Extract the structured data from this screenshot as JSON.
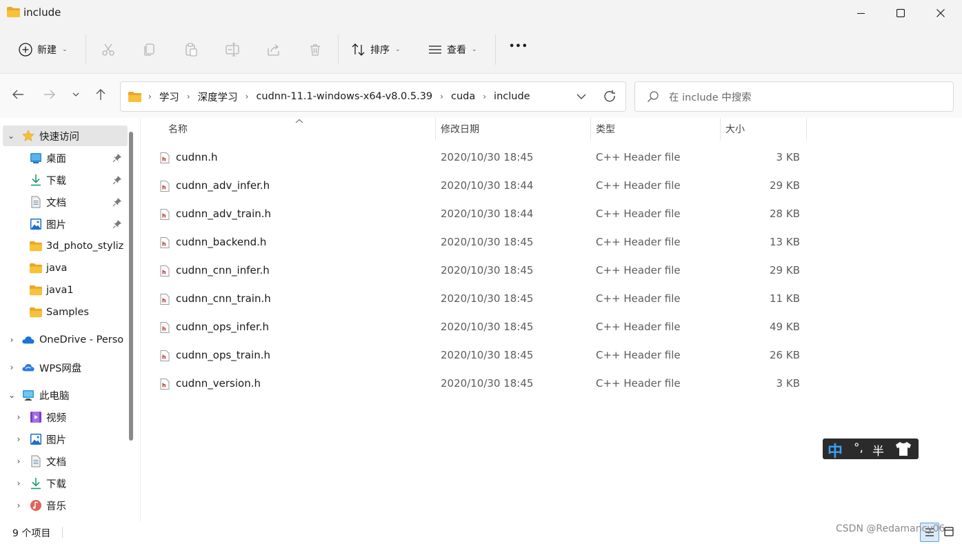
{
  "window": {
    "title": "include"
  },
  "toolbar": {
    "new_label": "新建",
    "sort_label": "排序",
    "view_label": "查看",
    "more_label": "•••"
  },
  "address": {
    "crumbs": [
      "学习",
      "深度学习",
      "cudnn-11.1-windows-x64-v8.0.5.39",
      "cuda",
      "include"
    ]
  },
  "search": {
    "placeholder": "在 include 中搜索"
  },
  "sidebar": {
    "quick_access": "快速访问",
    "items": [
      {
        "label": "桌面",
        "icon": "desktop-icon",
        "pinned": true
      },
      {
        "label": "下载",
        "icon": "download-icon",
        "pinned": true
      },
      {
        "label": "文档",
        "icon": "document-icon",
        "pinned": true
      },
      {
        "label": "图片",
        "icon": "pictures-icon",
        "pinned": true
      },
      {
        "label": "3d_photo_styliz",
        "icon": "folder-icon",
        "pinned": false
      },
      {
        "label": "java",
        "icon": "folder-icon",
        "pinned": false
      },
      {
        "label": "java1",
        "icon": "folder-icon",
        "pinned": false
      },
      {
        "label": "Samples",
        "icon": "folder-icon",
        "pinned": false
      }
    ],
    "onedrive": "OneDrive - Perso",
    "wps": "WPS网盘",
    "this_pc": "此电脑",
    "pc_items": [
      {
        "label": "视频",
        "icon": "video-icon"
      },
      {
        "label": "图片",
        "icon": "pictures-icon"
      },
      {
        "label": "文档",
        "icon": "document-icon"
      },
      {
        "label": "下载",
        "icon": "download-icon"
      },
      {
        "label": "音乐",
        "icon": "music-icon"
      }
    ]
  },
  "columns": {
    "name": "名称",
    "date": "修改日期",
    "type": "类型",
    "size": "大小"
  },
  "files": [
    {
      "name": "cudnn.h",
      "date": "2020/10/30 18:45",
      "type": "C++ Header file",
      "size": "3 KB"
    },
    {
      "name": "cudnn_adv_infer.h",
      "date": "2020/10/30 18:44",
      "type": "C++ Header file",
      "size": "29 KB"
    },
    {
      "name": "cudnn_adv_train.h",
      "date": "2020/10/30 18:44",
      "type": "C++ Header file",
      "size": "28 KB"
    },
    {
      "name": "cudnn_backend.h",
      "date": "2020/10/30 18:45",
      "type": "C++ Header file",
      "size": "13 KB"
    },
    {
      "name": "cudnn_cnn_infer.h",
      "date": "2020/10/30 18:45",
      "type": "C++ Header file",
      "size": "29 KB"
    },
    {
      "name": "cudnn_cnn_train.h",
      "date": "2020/10/30 18:45",
      "type": "C++ Header file",
      "size": "11 KB"
    },
    {
      "name": "cudnn_ops_infer.h",
      "date": "2020/10/30 18:45",
      "type": "C++ Header file",
      "size": "49 KB"
    },
    {
      "name": "cudnn_ops_train.h",
      "date": "2020/10/30 18:45",
      "type": "C++ Header file",
      "size": "26 KB"
    },
    {
      "name": "cudnn_version.h",
      "date": "2020/10/30 18:45",
      "type": "C++ Header file",
      "size": "3 KB"
    }
  ],
  "status": {
    "count_text": "9 个项目"
  },
  "ime": {
    "mode": "中",
    "punct": "°,",
    "width": "半"
  },
  "watermark": "CSDN @Redamancy06",
  "colors": {
    "accent": "#0067c0",
    "folder": "#f8c13a",
    "header_file_icon": "#b02525"
  }
}
